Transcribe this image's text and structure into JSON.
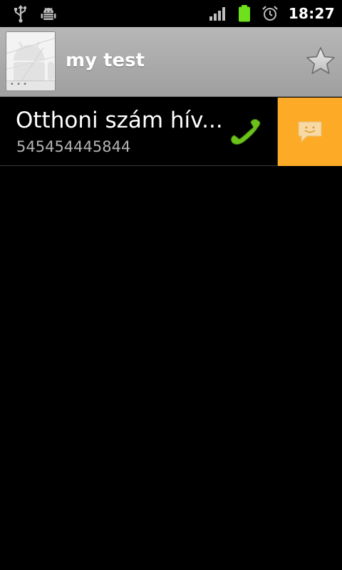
{
  "status_bar": {
    "icons_left": [
      "usb-icon",
      "android-debug-icon"
    ],
    "icons_right": [
      "signal-icon",
      "battery-icon",
      "alarm-icon"
    ],
    "time": "18:27",
    "battery_color": "#6ee01c"
  },
  "contact": {
    "name": "my test",
    "avatar_icon": "default-contact-avatar-icon",
    "starred": false
  },
  "phone_entry": {
    "label": "Otthoni szám hív...",
    "number": "545454445844",
    "call_icon": "phone-handset-icon",
    "call_icon_color": "#6cc21a",
    "sms_icon": "sms-bubble-icon",
    "sms_background": "#fdab26"
  }
}
